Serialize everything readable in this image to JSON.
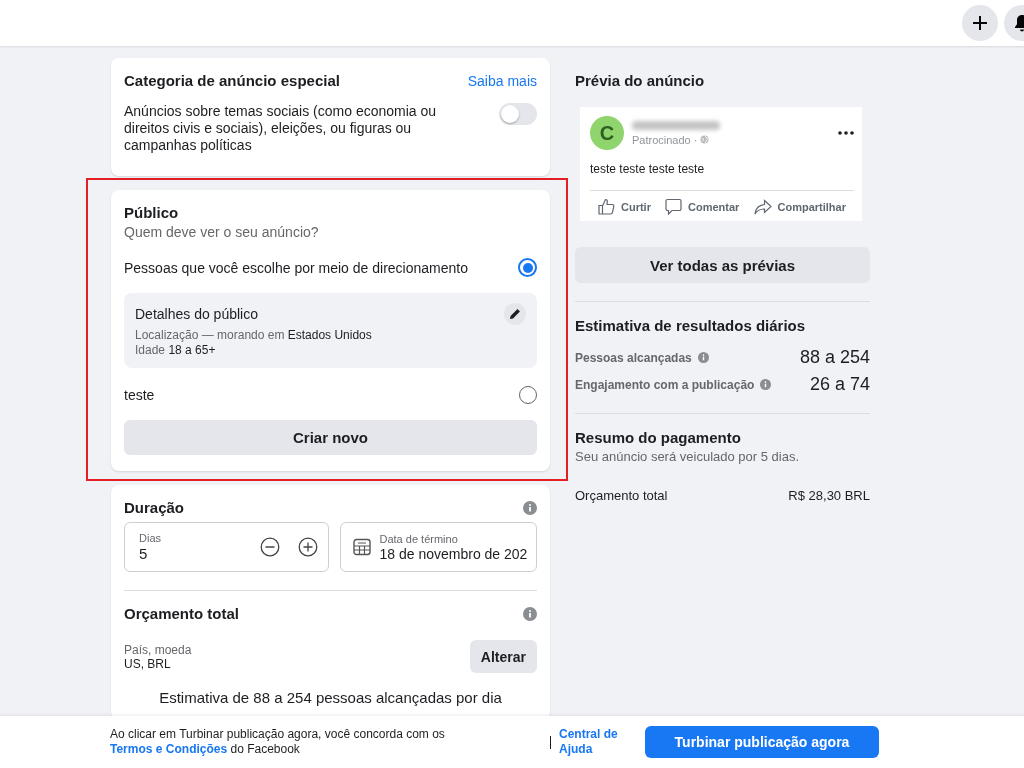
{
  "top_bar": {
    "buttons": [
      {
        "kind": "plus"
      },
      {
        "kind": "bell"
      }
    ]
  },
  "special_category": {
    "title": "Categoria de anúncio especial",
    "link": "Saiba mais",
    "description": "Anúncios sobre temas sociais (como economia ou direitos civis e sociais), eleições, ou figuras ou campanhas políticas",
    "toggle_on": false
  },
  "audience": {
    "highlighted": true,
    "title": "Público",
    "subtitle": "Quem deve ver o seu anúncio?",
    "options": [
      {
        "kind": "targeting",
        "label": "Pessoas que você escolhe por meio de direcionamento",
        "selected": true,
        "details": {
          "title": "Detalhes do público",
          "location_label": "Localização — morando em",
          "location_value": "Estados Unidos",
          "age_label": "Idade",
          "age_value": "18 a 65+"
        }
      },
      {
        "kind": "saved",
        "label": "teste",
        "selected": false
      }
    ],
    "create_button": "Criar novo"
  },
  "duration": {
    "title": "Duração",
    "days_label": "Dias",
    "days_value": "5",
    "end_label": "Data de término",
    "end_value": "18 de novembro de 202"
  },
  "budget": {
    "title": "Orçamento total",
    "country_label": "País, moeda",
    "country_value": "US, BRL",
    "change_button": "Alterar",
    "estimate": "Estimativa de 88 a 254 pessoas alcançadas por dia"
  },
  "preview": {
    "title": "Prévia do anúncio",
    "post": {
      "avatar_letter": "C",
      "sponsored": "Patrocinado ·",
      "text": "teste teste teste teste",
      "actions": [
        {
          "kind": "like",
          "label": "Curtir"
        },
        {
          "kind": "comment",
          "label": "Comentar"
        },
        {
          "kind": "share",
          "label": "Compartilhar"
        }
      ]
    },
    "all_previews_button": "Ver todas as prévias"
  },
  "daily_results": {
    "title": "Estimativa de resultados diários",
    "rows": [
      {
        "label": "Pessoas alcançadas",
        "value": "88 a 254"
      },
      {
        "label": "Engajamento com a publicação",
        "value": "26 a 74"
      }
    ]
  },
  "payment": {
    "title": "Resumo do pagamento",
    "subtitle": "Seu anúncio será veiculado por 5 dias.",
    "total_label": "Orçamento total",
    "total_value": "R$ 28,30 BRL"
  },
  "footer": {
    "text_before": "Ao clicar em Turbinar publicação agora, você concorda com os",
    "terms_link": "Termos e Condições",
    "text_after": "do Facebook",
    "help_link": "Central de Ajuda",
    "boost_button": "Turbinar publicação agora"
  }
}
